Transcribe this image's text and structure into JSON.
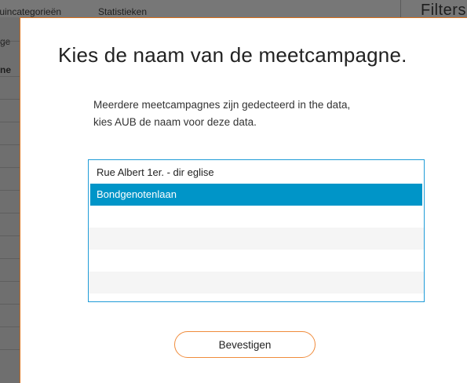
{
  "background": {
    "tabs": [
      "tuincategorieën",
      "Statistieken"
    ],
    "left_column_fragments": [
      "ge",
      "ne"
    ],
    "filters_label": "Filters"
  },
  "dialog": {
    "title": "Kies de naam van de meetcampagne.",
    "message_lines": [
      "Meerdere meetcampagnes zijn gedecteerd in the data,",
      "kies AUB de naam voor deze data."
    ],
    "list": {
      "items": [
        {
          "label": "Rue Albert 1er. - dir eglise",
          "selected": false
        },
        {
          "label": "Bondgenotenlaan",
          "selected": true
        },
        {
          "label": "",
          "selected": false
        },
        {
          "label": "",
          "selected": false
        },
        {
          "label": "",
          "selected": false
        },
        {
          "label": "",
          "selected": false
        }
      ]
    },
    "confirm_label": "Bevestigen"
  },
  "colors": {
    "accent_orange": "#f08c3c",
    "selection_blue": "#0095c8",
    "list_border": "#1f9cd8"
  }
}
